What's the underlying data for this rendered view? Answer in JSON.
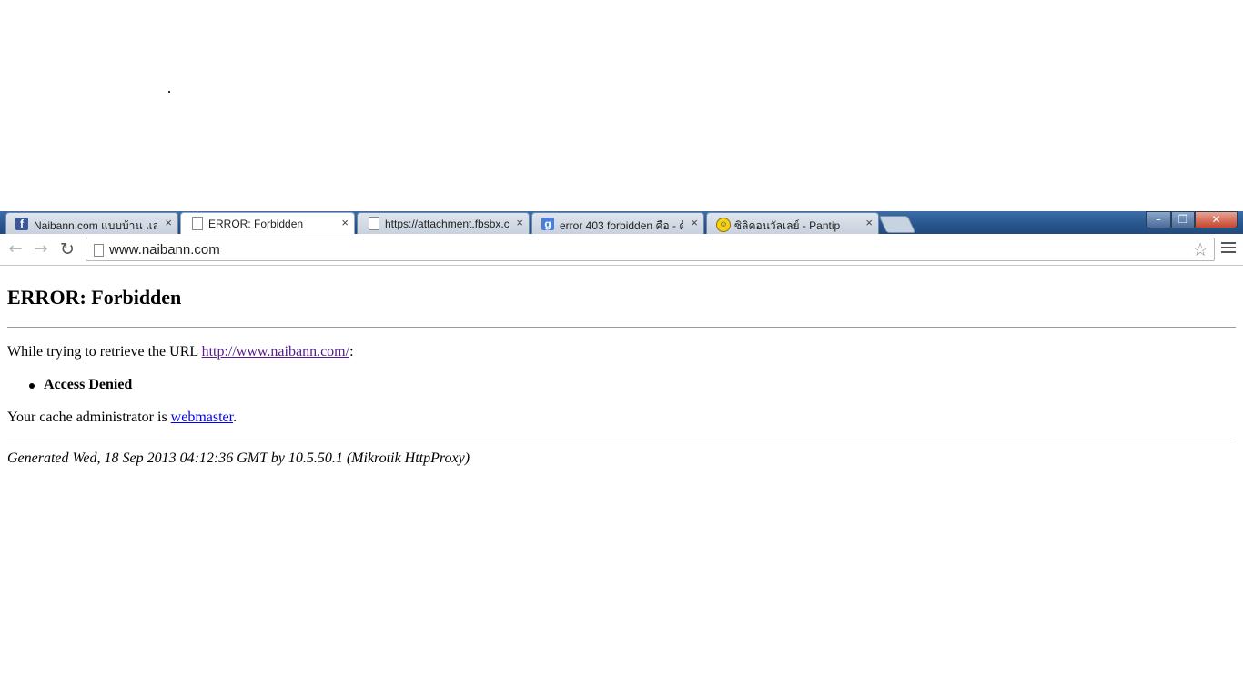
{
  "browser": {
    "tabs": [
      {
        "title": "Naibann.com แบบบ้าน และ",
        "favicon": "facebook-icon",
        "active": false
      },
      {
        "title": "ERROR: Forbidden",
        "favicon": "page-icon",
        "active": true
      },
      {
        "title": "https://attachment.fbsbx.c",
        "favicon": "page-icon",
        "active": false
      },
      {
        "title": "error 403 forbidden คือ - ค้",
        "favicon": "google-icon",
        "active": false
      },
      {
        "title": "ซิลิคอนวัลเลย์ - Pantip",
        "favicon": "pantip-icon",
        "active": false
      }
    ],
    "close_glyph": "×",
    "favicon_fb": "f",
    "favicon_g": "g",
    "favicon_pt": "☺",
    "address": "www.naibann.com",
    "window_controls": {
      "minimize": "–",
      "maximize": "❐",
      "close": "✕"
    },
    "nav": {
      "back": "←",
      "forward": "→",
      "reload": "↻",
      "star": "☆"
    }
  },
  "page": {
    "heading": "ERROR: Forbidden",
    "retrieve_prefix": "While trying to retrieve the URL ",
    "url_link": "http://www.naibann.com/",
    "retrieve_suffix": ":",
    "list_item": "Access Denied",
    "admin_prefix": "Your cache administrator is ",
    "admin_link": "webmaster",
    "admin_suffix": ".",
    "footer": "Generated Wed, 18 Sep 2013 04:12:36 GMT by 10.5.50.1 (Mikrotik HttpProxy)"
  },
  "colors": {
    "tabstrip": "#27558c",
    "visited_link": "#551a8b",
    "link": "#0000ee"
  }
}
